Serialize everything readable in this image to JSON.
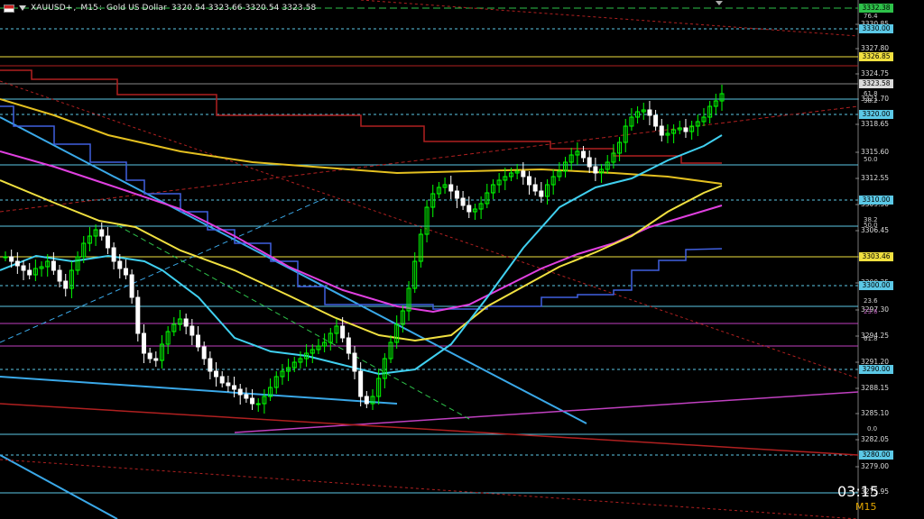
{
  "header": {
    "symbol": "XAUUSD+",
    "timeframe": "M15",
    "description": "Gold US Dollar",
    "ohlc": "3320.54 3323.66 3320.54 3323.58"
  },
  "price_axis": {
    "ticks": [
      "3330.85",
      "3327.80",
      "3324.75",
      "3321.70",
      "3318.65",
      "3315.60",
      "3312.55",
      "3309.50",
      "3306.45",
      "3303.40",
      "3300.35",
      "3297.30",
      "3294.25",
      "3291.20",
      "3288.15",
      "3285.10",
      "3282.05",
      "3279.00",
      "3275.95"
    ]
  },
  "price_tags": [
    {
      "value": "3332.38",
      "color": "#2ec24a"
    },
    {
      "value": "3330.00",
      "color": "#5bc8e6"
    },
    {
      "value": "3326.85",
      "color": "#f0e040"
    },
    {
      "value": "3323.58",
      "color": "#d9d9d9"
    },
    {
      "value": "3320.00",
      "color": "#5bc8e6"
    },
    {
      "value": "3310.00",
      "color": "#5bc8e6"
    },
    {
      "value": "3303.46",
      "color": "#f0e040"
    },
    {
      "value": "3300.00",
      "color": "#5bc8e6"
    },
    {
      "value": "3290.00",
      "color": "#5bc8e6"
    },
    {
      "value": "3280.00",
      "color": "#5bc8e6"
    }
  ],
  "fib_levels": [
    {
      "label": "76.4",
      "color": "#5bc8e6"
    },
    {
      "label": "61.8",
      "color": "#5bc8e6"
    },
    {
      "label": "38.2",
      "color": "#5bc8e6"
    },
    {
      "label": "50.0",
      "color": "#5bc8e6"
    },
    {
      "label": "38.2",
      "color": "#5bc8e6"
    },
    {
      "label": "50.0",
      "color": "#5bc8e6"
    },
    {
      "label": "23.6",
      "color": "#5bc8e6"
    },
    {
      "label": "23.6",
      "color": "#c040c0"
    },
    {
      "label": "61.8",
      "color": "#5bc8e6"
    },
    {
      "label": "0.0",
      "color": "#5bc8e6"
    }
  ],
  "clock": "03:15",
  "timeframe_badge": "M15",
  "colors": {
    "background": "#000000",
    "bull_candle": "#00ff00",
    "bear_candle": "#ffffff",
    "ma_fast": "#40d0f0",
    "ma_mid": "#f0e040",
    "ma_slow": "#e040e0",
    "cloud_line": "#4060e0",
    "resistance_step": "#b02020",
    "support_level": "#5bc8e6",
    "magenta_level": "#c040c0"
  }
}
